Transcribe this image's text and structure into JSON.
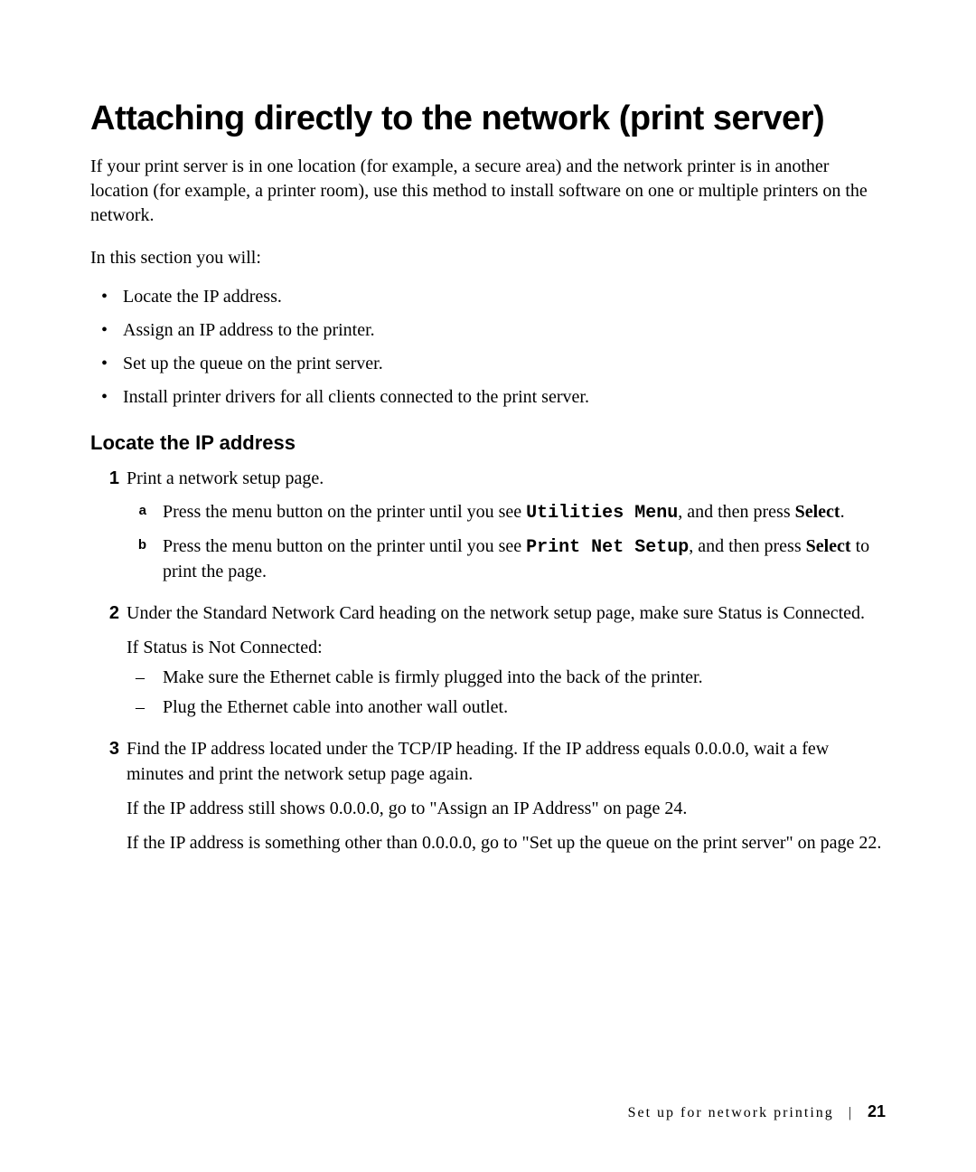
{
  "title": "Attaching directly to the network (print server)",
  "intro": "If your print server is in one location (for example, a secure area) and the network printer is in another location (for example, a printer room), use this method to install software on one or multiple printers on the network.",
  "lead": "In this section you will:",
  "bullets": [
    "Locate the IP address.",
    "Assign an IP address to the printer.",
    "Set up the queue on the print server.",
    "Install printer drivers for all clients connected to the print server."
  ],
  "subhead": "Locate the IP address",
  "steps": {
    "s1": {
      "marker": "1",
      "text": "Print a network setup page.",
      "a_marker": "a",
      "a_pre": "Press the menu button on the printer until you see ",
      "a_mono": "Utilities Menu",
      "a_mid": ", and then press ",
      "a_bold": "Select",
      "a_post": ".",
      "b_marker": "b",
      "b_pre": "Press the menu button on the printer until you see ",
      "b_mono": "Print Net Setup",
      "b_mid": ", and then press ",
      "b_bold": "Select",
      "b_post": " to print the page."
    },
    "s2": {
      "marker": "2",
      "text": "Under the Standard Network Card heading on the network setup page, make sure Status is Connected.",
      "after": "If Status is Not Connected:",
      "dashes": [
        "Make sure the Ethernet cable is firmly plugged into the back of the printer.",
        "Plug the Ethernet cable into another wall outlet."
      ]
    },
    "s3": {
      "marker": "3",
      "text": "Find the IP address located under the TCP/IP heading. If the IP address equals 0.0.0.0, wait a few minutes and print the network setup page again.",
      "p1": "If the IP address still shows 0.0.0.0, go to \"Assign an IP Address\" on page 24.",
      "p2": "If the IP address is something other than 0.0.0.0, go to \"Set up the queue on the print server\" on page 22."
    }
  },
  "footer": {
    "section": "Set up for network printing",
    "sep": "|",
    "page": "21"
  }
}
